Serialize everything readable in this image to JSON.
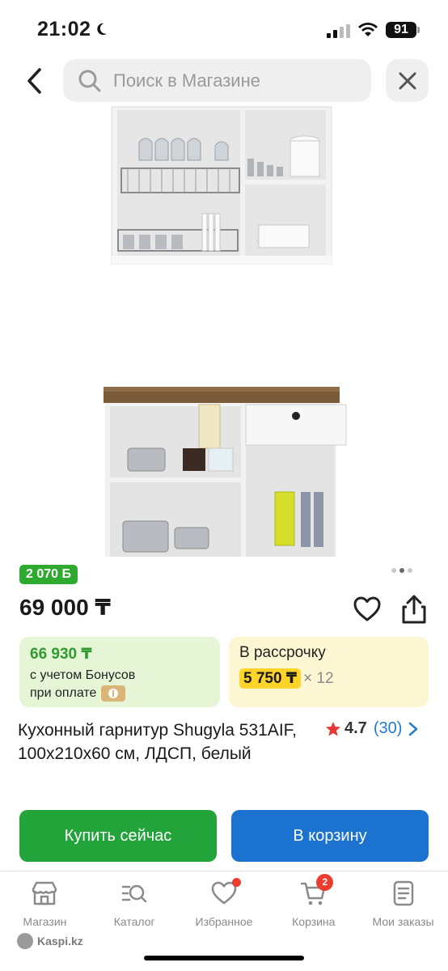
{
  "status_bar": {
    "time": "21:02",
    "battery": "91"
  },
  "search": {
    "placeholder": "Поиск в Магазине"
  },
  "product": {
    "bonus_badge": "2 070 Б",
    "price": "69 000 ₸",
    "bonus_card": {
      "amount": "66 930 ₸",
      "line1": "с учетом Бонусов",
      "line2": "при оплате"
    },
    "installment_card": {
      "title": "В рассрочку",
      "amount": "5 750 ₸",
      "multiplier": "× 12"
    },
    "title": "Кухонный гарнитур Shugyla 531AIF, 100x210x60 см, ЛДСП, белый",
    "rating": {
      "value": "4.7",
      "count": "(30)"
    },
    "image_pager": {
      "total": 3,
      "active": 2
    }
  },
  "actions": {
    "buy_now": "Купить сейчас",
    "to_cart": "В корзину"
  },
  "tabbar": {
    "items": [
      {
        "label": "Магазин",
        "icon": "store-icon"
      },
      {
        "label": "Каталог",
        "icon": "catalog-search-icon"
      },
      {
        "label": "Избранное",
        "icon": "heart-icon"
      },
      {
        "label": "Корзина",
        "icon": "cart-icon",
        "badge": "2"
      },
      {
        "label": "Мои заказы",
        "icon": "orders-icon"
      }
    ]
  },
  "footer": {
    "brand": "Kaspi.kz"
  },
  "colors": {
    "green": "#23a43b",
    "blue": "#1c73cf",
    "badge_red": "#ef3b2d",
    "installment_yellow": "#ffd42a"
  }
}
